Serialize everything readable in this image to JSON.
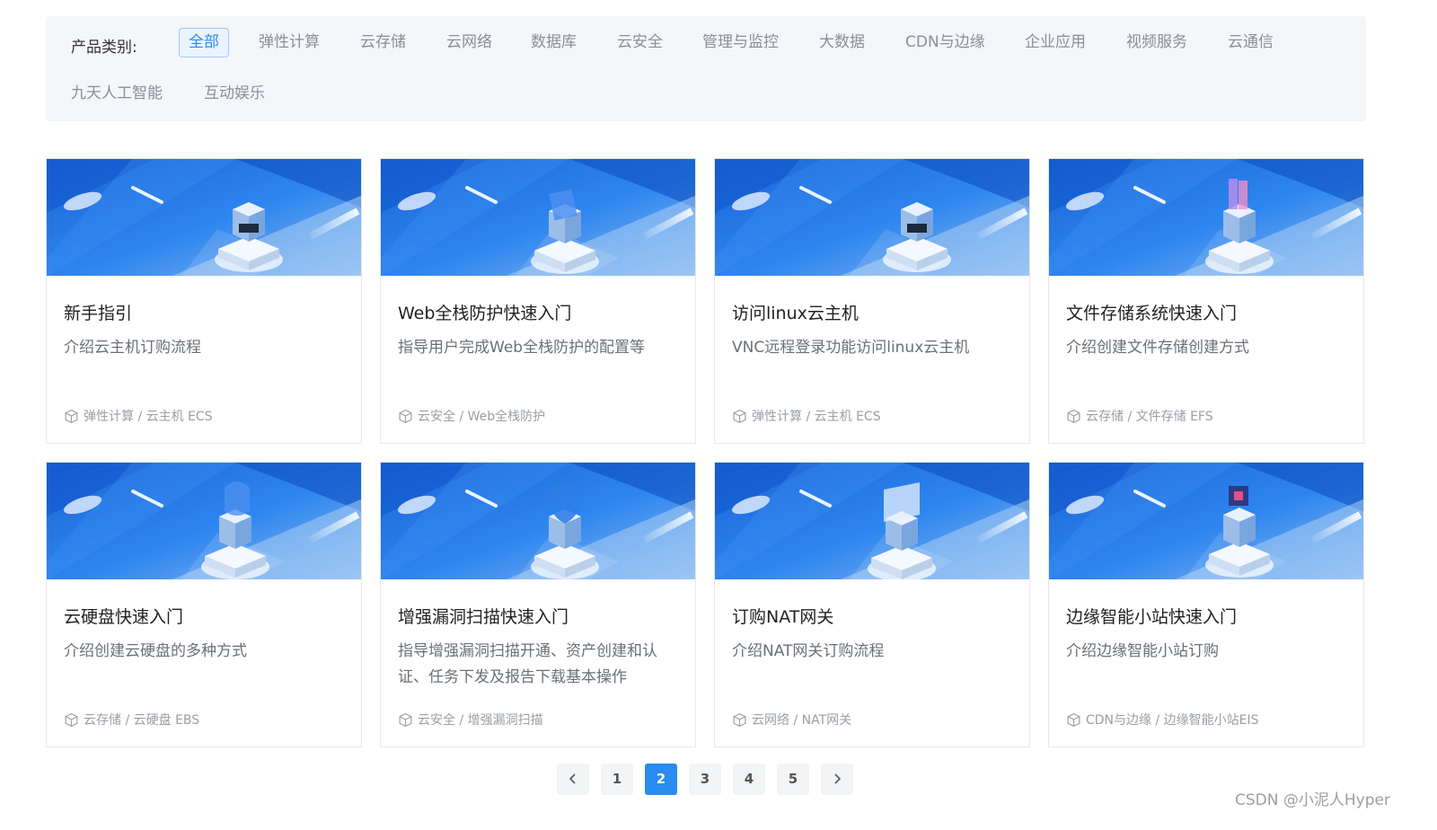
{
  "filter": {
    "label": "产品类别:",
    "items": [
      "全部",
      "弹性计算",
      "云存储",
      "云网络",
      "数据库",
      "云安全",
      "管理与监控",
      "大数据",
      "CDN与边缘",
      "企业应用",
      "视频服务",
      "云通信",
      "九天人工智能",
      "互动娱乐"
    ],
    "active": "全部"
  },
  "cards": [
    {
      "title": "新手指引",
      "desc": "介绍云主机订购流程",
      "meta": "弹性计算 / 云主机 ECS"
    },
    {
      "title": "Web全栈防护快速入门",
      "desc": "指导用户完成Web全栈防护的配置等",
      "meta": "云安全 / Web全栈防护"
    },
    {
      "title": "访问linux云主机",
      "desc": "VNC远程登录功能访问linux云主机",
      "meta": "弹性计算 / 云主机 ECS"
    },
    {
      "title": "文件存储系统快速入门",
      "desc": "介绍创建文件存储创建方式",
      "meta": "云存储 / 文件存储 EFS"
    },
    {
      "title": "云硬盘快速入门",
      "desc": "介绍创建云硬盘的多种方式",
      "meta": "云存储 / 云硬盘 EBS"
    },
    {
      "title": "增强漏洞扫描快速入门",
      "desc": "指导增强漏洞扫描开通、资产创建和认证、任务下发及报告下载基本操作",
      "meta": "云安全 / 增强漏洞扫描"
    },
    {
      "title": "订购NAT网关",
      "desc": "介绍NAT网关订购流程",
      "meta": "云网络 / NAT网关"
    },
    {
      "title": "边缘智能小站快速入门",
      "desc": "介绍边缘智能小站订购",
      "meta": "CDN与边缘 / 边缘智能小站EIS"
    }
  ],
  "pagination": {
    "pages": [
      "1",
      "2",
      "3",
      "4",
      "5"
    ],
    "current": "2",
    "prev_icon": "chevron-left-icon",
    "next_icon": "chevron-right-icon"
  },
  "watermark": "CSDN @小泥人Hyper",
  "colors": {
    "accent": "#2a8bf0",
    "banner_dark": "#1f6fe0",
    "banner_light": "#8fbdf0",
    "filter_bg": "#f4f6fa"
  }
}
